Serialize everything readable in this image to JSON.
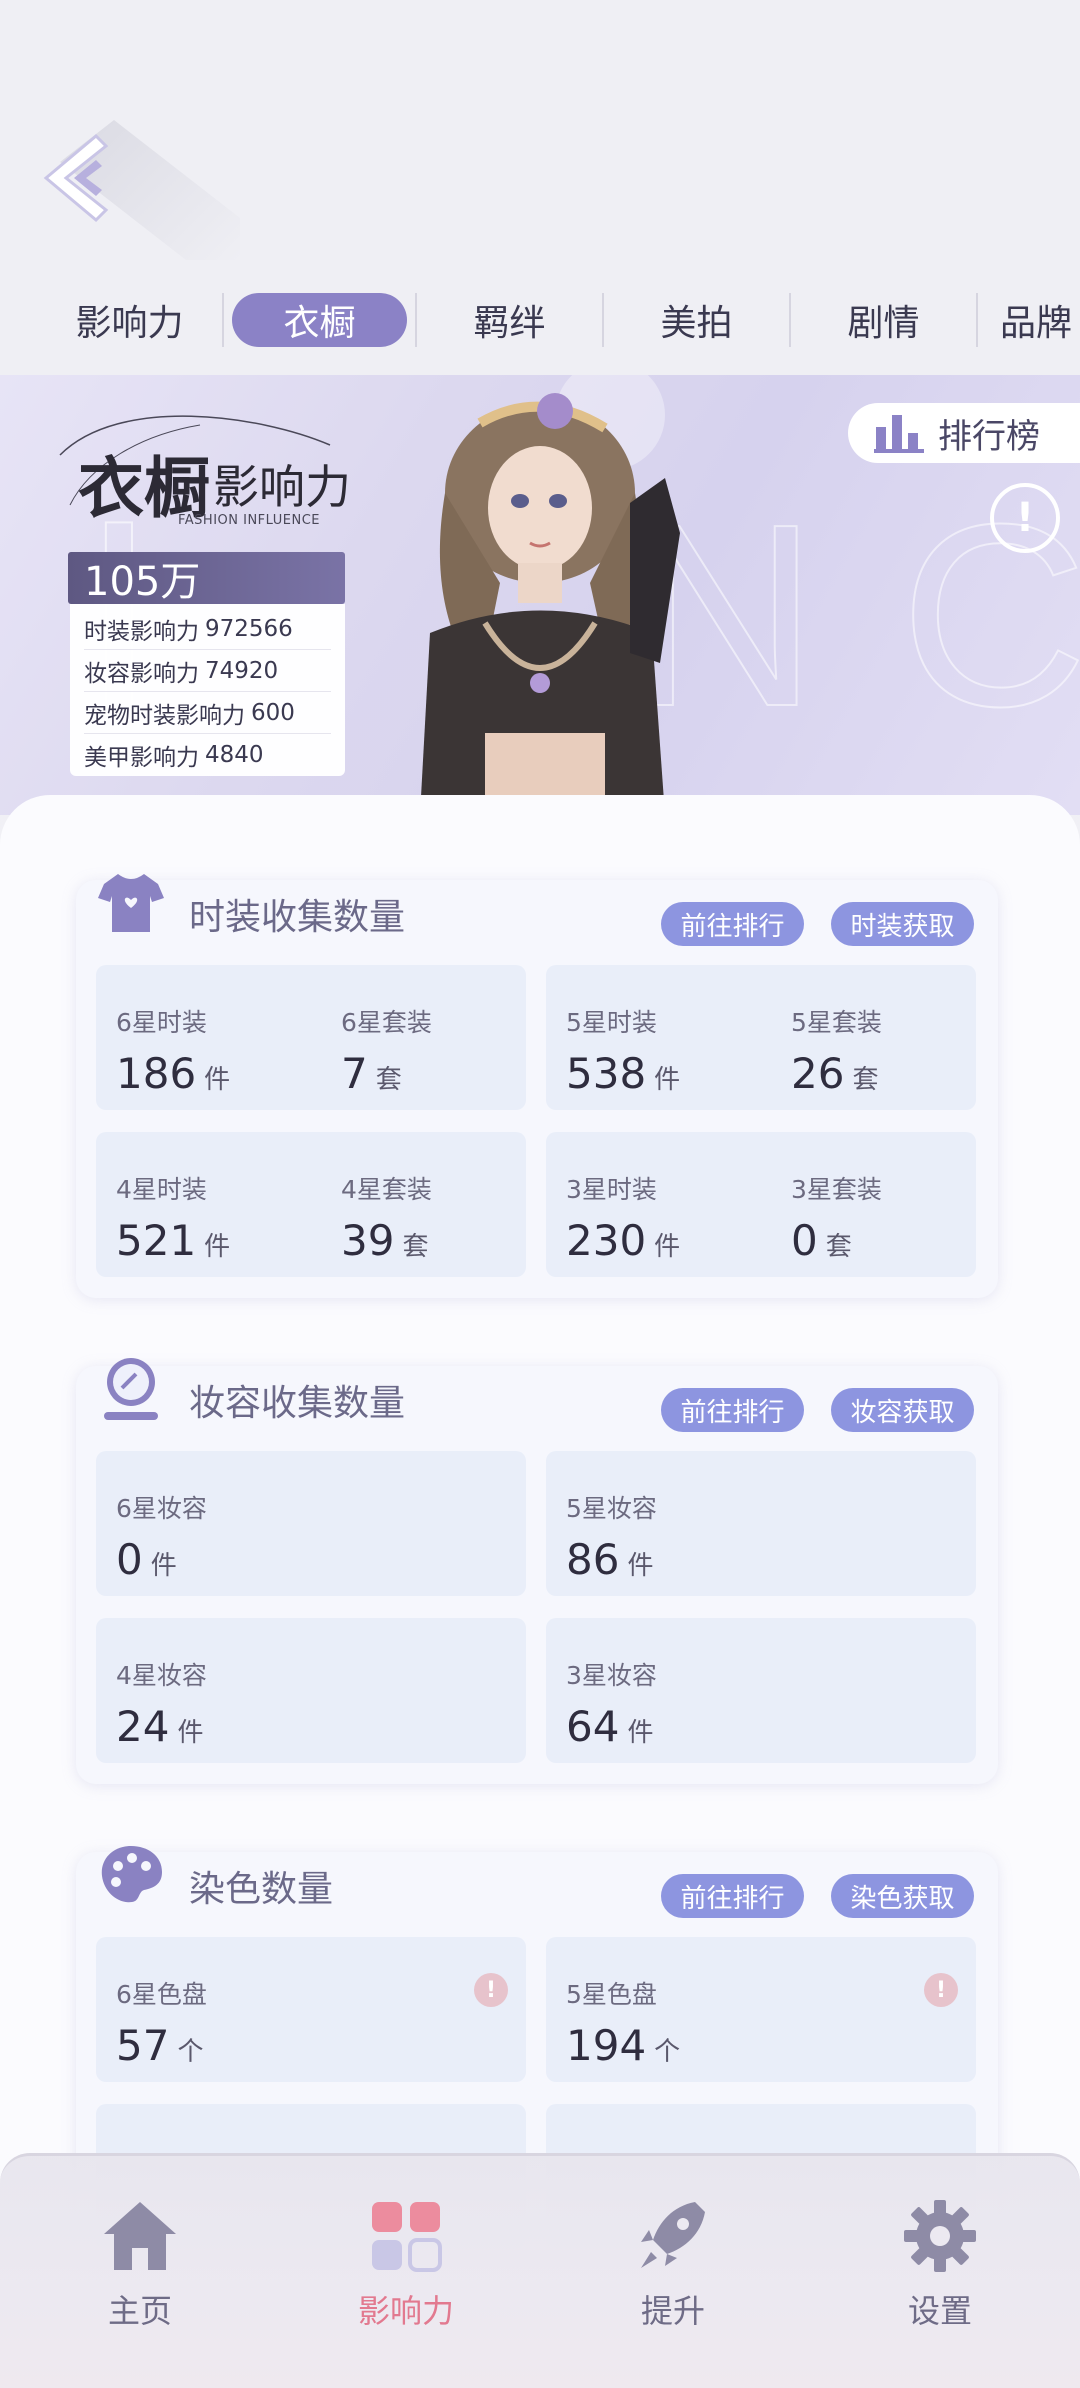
{
  "tabs": [
    "影响力",
    "衣橱",
    "羁绊",
    "美拍",
    "剧情",
    "品牌"
  ],
  "active_tab": "衣橱",
  "banner": {
    "title_main": "衣橱",
    "title_sub": "影响力",
    "title_en": "FASHION INFLUENCE",
    "total": "105万",
    "stats": [
      {
        "label": "时装影响力",
        "value": "972566"
      },
      {
        "label": "妆容影响力",
        "value": "74920"
      },
      {
        "label": "宠物时装影响力",
        "value": "600"
      },
      {
        "label": "美甲影响力",
        "value": "4840"
      }
    ],
    "rank_label": "排行榜"
  },
  "sections": {
    "fashion": {
      "title": "时装收集数量",
      "rank_btn": "前往排行",
      "get_btn": "时装获取",
      "cards": [
        {
          "a_label": "6星时装",
          "a_num": "186",
          "a_unit": "件",
          "b_label": "6星套装",
          "b_num": "7",
          "b_unit": "套"
        },
        {
          "a_label": "5星时装",
          "a_num": "538",
          "a_unit": "件",
          "b_label": "5星套装",
          "b_num": "26",
          "b_unit": "套"
        },
        {
          "a_label": "4星时装",
          "a_num": "521",
          "a_unit": "件",
          "b_label": "4星套装",
          "b_num": "39",
          "b_unit": "套"
        },
        {
          "a_label": "3星时装",
          "a_num": "230",
          "a_unit": "件",
          "b_label": "3星套装",
          "b_num": "0",
          "b_unit": "套"
        }
      ]
    },
    "makeup": {
      "title": "妆容收集数量",
      "rank_btn": "前往排行",
      "get_btn": "妆容获取",
      "cards": [
        {
          "label": "6星妆容",
          "num": "0",
          "unit": "件"
        },
        {
          "label": "5星妆容",
          "num": "86",
          "unit": "件"
        },
        {
          "label": "4星妆容",
          "num": "24",
          "unit": "件"
        },
        {
          "label": "3星妆容",
          "num": "64",
          "unit": "件"
        }
      ]
    },
    "dye": {
      "title": "染色数量",
      "rank_btn": "前往排行",
      "get_btn": "染色获取",
      "cards": [
        {
          "label": "6星色盘",
          "num": "57",
          "unit": "个"
        },
        {
          "label": "5星色盘",
          "num": "194",
          "unit": "个"
        }
      ]
    }
  },
  "nav": [
    {
      "label": "主页",
      "icon": "home-icon"
    },
    {
      "label": "影响力",
      "icon": "influence-grid-icon",
      "active": true
    },
    {
      "label": "提升",
      "icon": "rocket-icon"
    },
    {
      "label": "设置",
      "icon": "gear-icon"
    }
  ],
  "colors": {
    "accent": "#8b82c6",
    "pill": "#8d95e0",
    "nav_active": "#e2798f"
  }
}
